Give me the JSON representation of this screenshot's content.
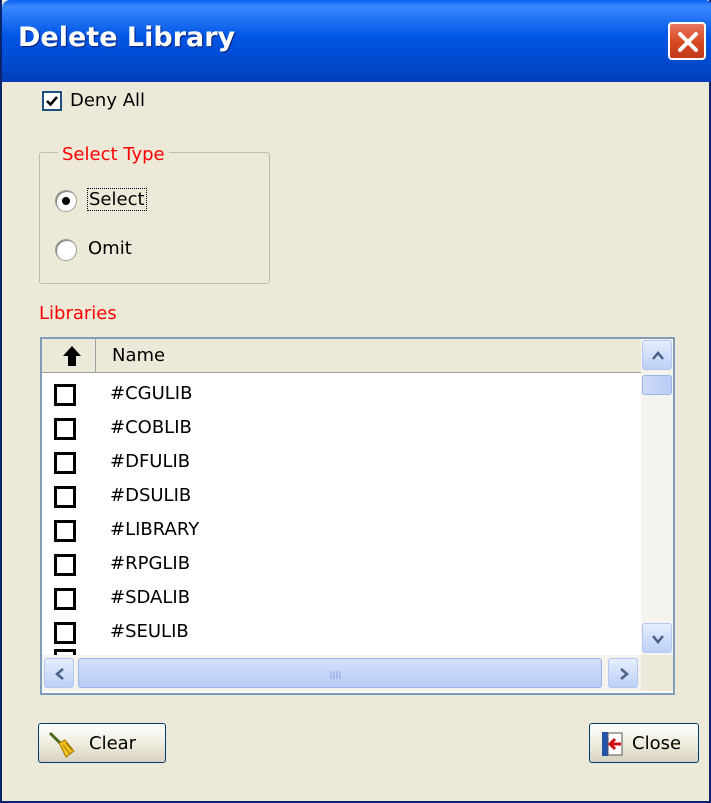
{
  "window": {
    "title": "Delete Library"
  },
  "deny_all": {
    "label": "Deny All",
    "checked": true
  },
  "select_type": {
    "legend": "Select Type",
    "options": [
      {
        "label": "Select",
        "selected": true
      },
      {
        "label": "Omit",
        "selected": false
      }
    ]
  },
  "libraries": {
    "label": "Libraries",
    "column_header": "Name",
    "rows": [
      "#CGULIB",
      "#COBLIB",
      "#DFULIB",
      "#DSULIB",
      "#LIBRARY",
      "#RPGLIB",
      "#SDALIB",
      "#SEULIB"
    ]
  },
  "buttons": {
    "clear": "Clear",
    "close": "Close"
  },
  "colors": {
    "accent_red": "#ff0000",
    "titlebar_blue": "#0055e5"
  }
}
